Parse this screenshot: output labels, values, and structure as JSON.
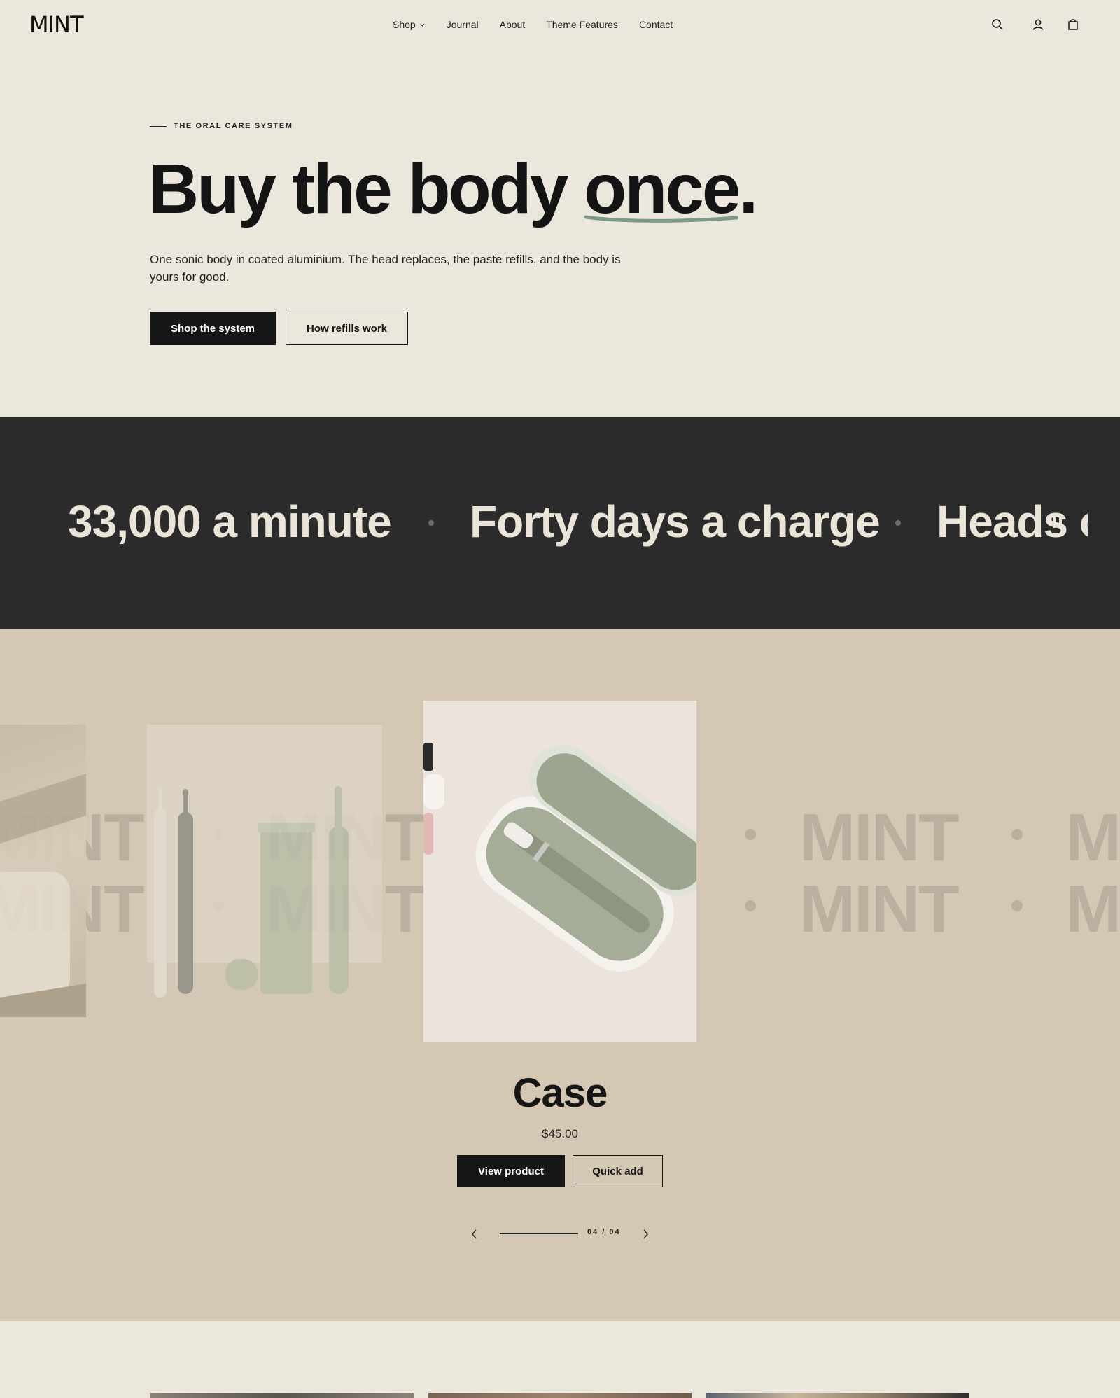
{
  "header": {
    "logo": "MINT",
    "nav": [
      {
        "label": "Shop"
      },
      {
        "label": "Journal"
      },
      {
        "label": "About"
      },
      {
        "label": "Theme Features"
      },
      {
        "label": "Contact"
      }
    ],
    "icons": [
      "search-icon",
      "account-icon",
      "cart-icon"
    ]
  },
  "hero": {
    "eyebrow": "THE ORAL CARE SYSTEM",
    "headline_part1": "Buy the body ",
    "headline_underlined": "once",
    "headline_end": ".",
    "description": "One sonic body in coated aluminium. The head replaces, the paste refills, and the body is yours for good.",
    "primary_button": "Shop the system",
    "secondary_button": "How refills work",
    "underline_color": "#7e9a86"
  },
  "marquee": {
    "items": [
      "33,000 a minute",
      "Forty days a charge",
      "Heads o"
    ],
    "background": "#2b2b2b"
  },
  "carousel": {
    "watermark": "MINT",
    "product_title": "Case",
    "product_price": "$45.00",
    "view_button": "View product",
    "quick_add_button": "Quick add",
    "counter": "04 / 04",
    "progress": 1.0,
    "background": "#d4c8b5"
  },
  "colors": {
    "page_bg": "#ece7dd",
    "dark": "#161616",
    "sage": "#a9b29b"
  }
}
